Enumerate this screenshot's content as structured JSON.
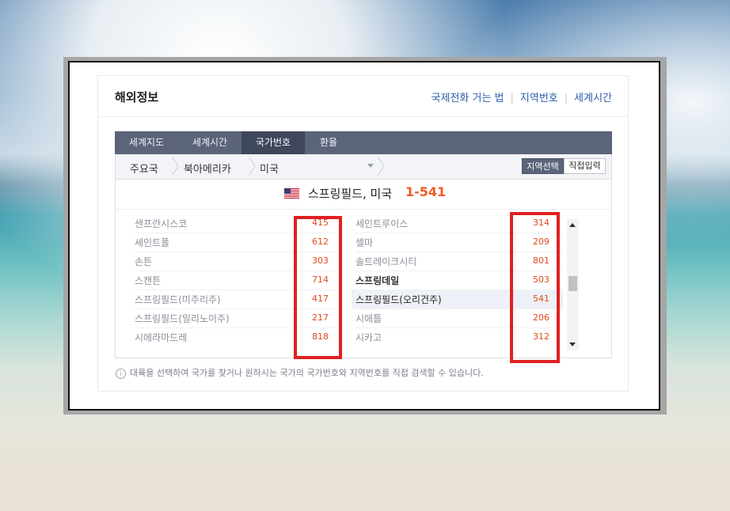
{
  "panel": {
    "title": "해외정보",
    "links": [
      "국제전화 거는 법",
      "지역번호",
      "세계시간"
    ]
  },
  "tabs": [
    "세계지도",
    "세계시간",
    "국가번호",
    "환율"
  ],
  "active_tab": 2,
  "crumbs": {
    "level1": "주요국",
    "level2": "북아메리카",
    "level3": "미국",
    "btn_region": "지역선택",
    "btn_direct": "직접입력"
  },
  "selected": {
    "city": "스프링필드, 미국",
    "code": "1-541",
    "flag_icon": "us-flag-icon"
  },
  "left_list": [
    {
      "name": "샌프란시스코",
      "code": "415"
    },
    {
      "name": "세인트폴",
      "code": "612"
    },
    {
      "name": "손튼",
      "code": "303"
    },
    {
      "name": "스캔튼",
      "code": "714"
    },
    {
      "name": "스프링필드(미주리주)",
      "code": "417"
    },
    {
      "name": "스프링필드(일리노이주)",
      "code": "217"
    },
    {
      "name": "시에라마드레",
      "code": "818"
    }
  ],
  "right_list": [
    {
      "name": "세인트루이스",
      "code": "314"
    },
    {
      "name": "셀마",
      "code": "209"
    },
    {
      "name": "솔트레이크시티",
      "code": "801"
    },
    {
      "name": "스프링데일",
      "code": "503"
    },
    {
      "name": "스프링필드(오리건주)",
      "code": "541"
    },
    {
      "name": "시애틀",
      "code": "206"
    },
    {
      "name": "시카고",
      "code": "312"
    }
  ],
  "note": "대륙을 선택하여 국가를 찾거나 원하시는 국가의 국가번호와 지역번호를 직접 검색할 수 있습니다.",
  "colors": {
    "accent_orange": "#f15a22",
    "tab_bg": "#5b6479",
    "annotation_red": "#e02020"
  }
}
